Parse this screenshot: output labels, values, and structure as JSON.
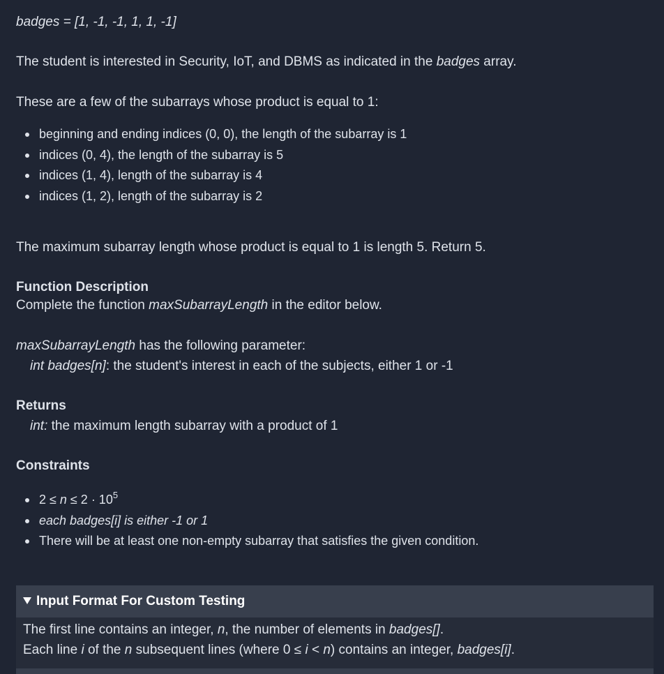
{
  "example": {
    "line": "badges = [1, -1, -1, 1, 1, -1]"
  },
  "interest": {
    "before": "The student is interested in Security, IoT, and DBMS as indicated in the ",
    "var": "badges",
    "after": " array."
  },
  "subarrays_intro": "These are a few of the subarrays whose product is equal to 1:",
  "subarray_examples": [
    "beginning and ending indices (0, 0), the length of the subarray is 1",
    "indices (0, 4), the length of the subarray is 5",
    "indices (1, 4), length of the subarray is 4",
    "indices (1, 2), length of the subarray is 2"
  ],
  "max_statement": "The maximum subarray length whose product is equal to 1 is length 5. Return 5.",
  "function_description": {
    "heading": "Function Description",
    "before": "Complete the function ",
    "func_name": "maxSubarrayLength",
    "after": " in the editor below."
  },
  "parameters": {
    "func_name": "maxSubarrayLength",
    "intro": " has the following parameter:",
    "param_name": "int badges[n]",
    "param_desc": ": the student's interest in each of the subjects, either 1 or -1"
  },
  "returns": {
    "heading": "Returns",
    "type": "int:",
    "desc": " the maximum length subarray with a product of 1"
  },
  "constraints": {
    "heading": "Constraints",
    "c1": {
      "a": "2 ≤ ",
      "n": "n",
      "b": " ≤ 2 · 10",
      "exp": "5"
    },
    "c2": "each badges[i] is either -1 or 1",
    "c3": "There will be at least one non-empty subarray that satisfies the given condition."
  },
  "input_format": {
    "title": "Input Format For Custom Testing",
    "line1": {
      "a": "The first line contains an integer, ",
      "n": "n",
      "b": ", the number of elements in ",
      "arr": "badges[]",
      "c": "."
    },
    "line2": {
      "a": "Each line ",
      "i": "i",
      "b": " of the ",
      "n": "n",
      "c": " subsequent lines (where 0 ≤ ",
      "i2": "i",
      "d": " < ",
      "n2": "n",
      "e": ") contains an integer, ",
      "elem": "badges[i]",
      "f": "."
    }
  },
  "colors": {
    "background": "#1f2533",
    "text": "#dfe3ea",
    "panel_header": "#383f4d",
    "panel_body": "#262c39"
  }
}
